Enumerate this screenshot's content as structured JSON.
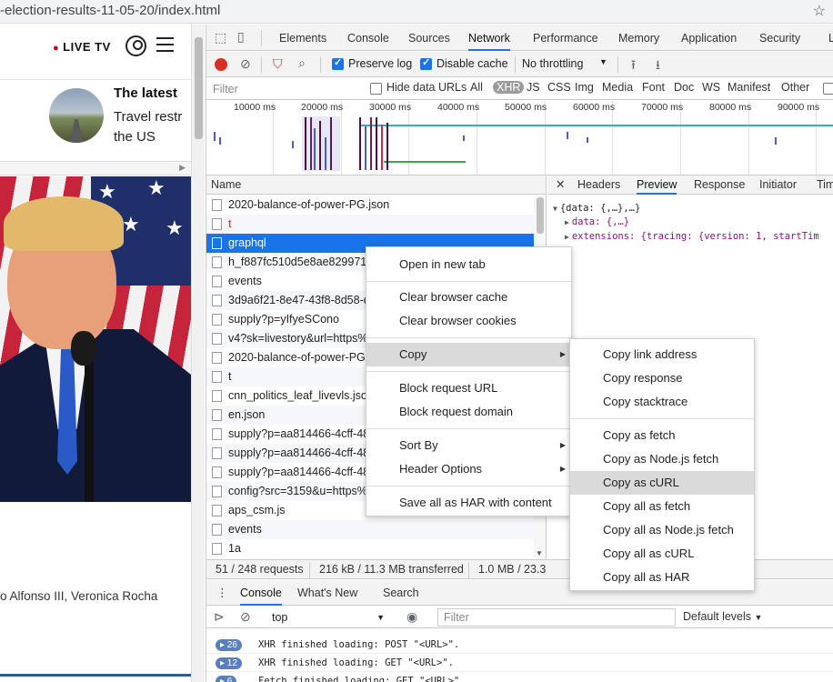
{
  "browser": {
    "url_fragment": "-election-results-11-05-20/index.html"
  },
  "page": {
    "live_tv": "LIVE TV",
    "latest_title": "The latest",
    "latest_lines": [
      "Travel restr",
      "the US"
    ],
    "byline": "o Alfonso III, Veronica Rocha"
  },
  "devtools": {
    "tabs": [
      "Elements",
      "Console",
      "Sources",
      "Network",
      "Performance",
      "Memory",
      "Application",
      "Security",
      "L"
    ],
    "active_tab": "Network",
    "toolbar": {
      "preserve_log": "Preserve log",
      "disable_cache": "Disable cache",
      "throttling": "No throttling"
    },
    "filter": {
      "placeholder": "Filter",
      "hide_data_urls": "Hide data URLs",
      "types": [
        "All",
        "XHR",
        "JS",
        "CSS",
        "Img",
        "Media",
        "Font",
        "Doc",
        "WS",
        "Manifest",
        "Other"
      ],
      "selected_type": "XHR"
    },
    "timeline_ticks": [
      "10000 ms",
      "20000 ms",
      "30000 ms",
      "40000 ms",
      "50000 ms",
      "60000 ms",
      "70000 ms",
      "80000 ms",
      "90000 ms"
    ],
    "requests": {
      "header": "Name",
      "rows": [
        {
          "name": "2020-balance-of-power-PG.json",
          "state": "normal"
        },
        {
          "name": "t",
          "state": "red"
        },
        {
          "name": "graphql",
          "state": "selected"
        },
        {
          "name": "h_f887fc510d5e8ae829971a",
          "state": "normal"
        },
        {
          "name": "events",
          "state": "normal"
        },
        {
          "name": "3d9a6f21-8e47-43f8-8d58-d",
          "state": "normal"
        },
        {
          "name": "supply?p=yIfyeSCono",
          "state": "normal"
        },
        {
          "name": "v4?sk=livestory&url=https%",
          "state": "normal"
        },
        {
          "name": "2020-balance-of-power-PG.js",
          "state": "normal"
        },
        {
          "name": "t",
          "state": "normal"
        },
        {
          "name": "cnn_politics_leaf_livevls.json",
          "state": "normal"
        },
        {
          "name": "en.json",
          "state": "normal"
        },
        {
          "name": "supply?p=aa814466-4cff-48f",
          "state": "normal"
        },
        {
          "name": "supply?p=aa814466-4cff-48f",
          "state": "normal"
        },
        {
          "name": "supply?p=aa814466-4cff-48f",
          "state": "normal"
        },
        {
          "name": "config?src=3159&u=https%3",
          "state": "normal"
        },
        {
          "name": "aps_csm.js",
          "state": "normal"
        },
        {
          "name": "events",
          "state": "normal"
        },
        {
          "name": "1a",
          "state": "normal"
        }
      ]
    },
    "preview": {
      "tabs": [
        "Headers",
        "Preview",
        "Response",
        "Initiator",
        "Tim"
      ],
      "active_tab": "Preview",
      "lines": [
        "{data: {,…},…}",
        "data: {,…}",
        "extensions: {tracing: {version: 1, startTim"
      ]
    },
    "status": {
      "requests": "51 / 248 requests",
      "transferred": "216 kB / 11.3 MB transferred",
      "resources": "1.0 MB / 23.3"
    },
    "drawer": {
      "tabs": [
        "Console",
        "What's New",
        "Search"
      ],
      "active_tab": "Console",
      "context": "top",
      "filter_placeholder": "Filter",
      "levels": "Default levels"
    },
    "console_logs": [
      {
        "count": "26",
        "message": "XHR finished loading: POST \"<URL>\"."
      },
      {
        "count": "12",
        "message": "XHR finished loading: GET \"<URL>\"."
      },
      {
        "count": "6",
        "message": "Fetch finished loading: GET \"<URL>\"."
      }
    ]
  },
  "context_menu": {
    "items": [
      "Open in new tab",
      "Clear browser cache",
      "Clear browser cookies",
      "Copy",
      "Block request URL",
      "Block request domain",
      "Sort By",
      "Header Options",
      "Save all as HAR with content"
    ],
    "highlighted": "Copy"
  },
  "copy_submenu": {
    "items": [
      "Copy link address",
      "Copy response",
      "Copy stacktrace",
      "Copy as fetch",
      "Copy as Node.js fetch",
      "Copy as cURL",
      "Copy all as fetch",
      "Copy all as Node.js fetch",
      "Copy all as cURL",
      "Copy all as HAR"
    ],
    "highlighted": "Copy as cURL"
  },
  "colors": {
    "accent": "#1a73e8",
    "record": "#d93025",
    "menu_highlight": "#dadada"
  }
}
